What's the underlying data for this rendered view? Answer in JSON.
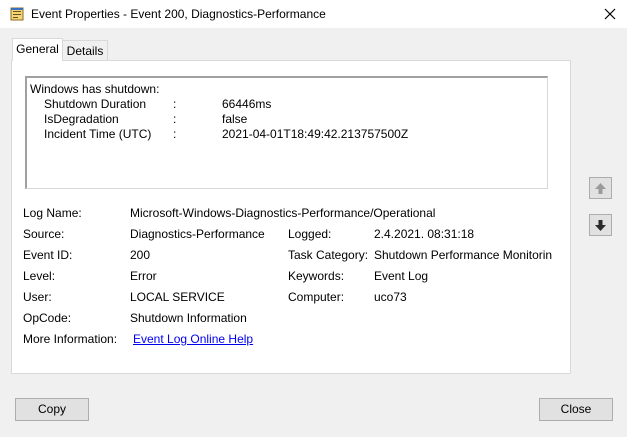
{
  "window": {
    "title": "Event Properties - Event 200, Diagnostics-Performance",
    "close_glyph": "✕"
  },
  "tabs": [
    {
      "label": "General",
      "selected": true
    },
    {
      "label": "Details",
      "selected": false
    }
  ],
  "description": {
    "heading": "Windows has shutdown:",
    "rows": [
      {
        "label": "Shutdown Duration",
        "sep": ":",
        "value": "66446ms"
      },
      {
        "label": "IsDegradation",
        "sep": ":",
        "value": "false"
      },
      {
        "label": "Incident Time (UTC)",
        "sep": ":",
        "value": "2021-04-01T18:49:42.213757500Z"
      }
    ]
  },
  "details": {
    "log_name": {
      "label": "Log Name:",
      "value": "Microsoft-Windows-Diagnostics-Performance/Operational"
    },
    "source": {
      "label": "Source:",
      "value": "Diagnostics-Performance"
    },
    "logged": {
      "label": "Logged:",
      "value": "2.4.2021. 08:31:18"
    },
    "event_id": {
      "label": "Event ID:",
      "value": "200"
    },
    "task_category": {
      "label": "Task Category:",
      "value": "Shutdown Performance Monitorin"
    },
    "level": {
      "label": "Level:",
      "value": "Error"
    },
    "keywords": {
      "label": "Keywords:",
      "value": "Event Log"
    },
    "user": {
      "label": "User:",
      "value": "LOCAL SERVICE"
    },
    "computer": {
      "label": "Computer:",
      "value": "uco73"
    },
    "opcode": {
      "label": "OpCode:",
      "value": "Shutdown Information"
    },
    "more_info": {
      "label": "More Information:",
      "link": "Event Log Online Help"
    }
  },
  "buttons": {
    "copy": "Copy",
    "close": "Close"
  },
  "icons": {
    "app": "event-properties-icon",
    "up": "arrow-up-icon",
    "down": "arrow-down-icon"
  }
}
